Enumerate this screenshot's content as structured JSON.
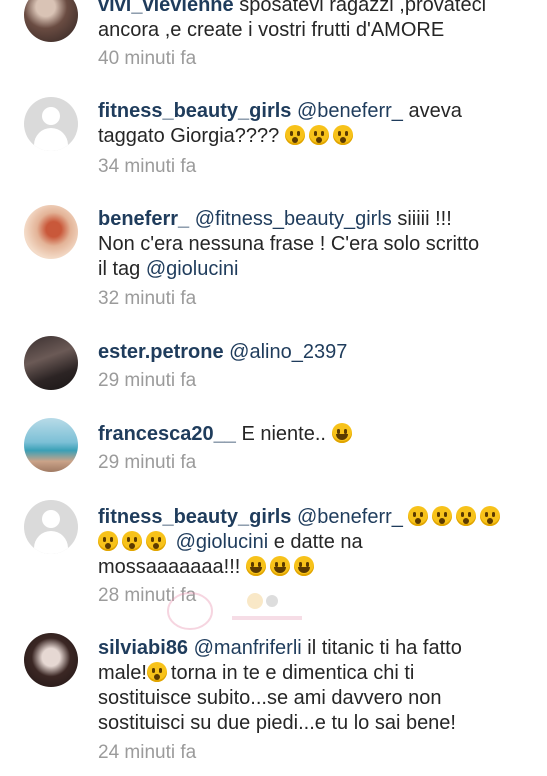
{
  "comments": [
    {
      "user": "vivi_vievienne",
      "parts": [
        "sposatevi ragazzi ,provateci",
        "ancora ,e create i vostri frutti d'AMORE"
      ],
      "time": "40 minuti fa"
    },
    {
      "user": "fitness_beauty_girls",
      "mention": "@beneferr_",
      "text_a": " aveva",
      "text_b": "taggato Giorgia????",
      "time": "34 minuti fa"
    },
    {
      "user": "beneferr_",
      "mention": "@fitness_beauty_girls",
      "text_a": " siiiii !!!",
      "text_b": "Non c'era nessuna frase ! C'era solo scritto",
      "text_c": "il tag ",
      "mention2": "@giolucini",
      "time": "32 minuti fa"
    },
    {
      "user": "ester.petrone",
      "mention": "@alino_2397",
      "time": "29 minuti fa"
    },
    {
      "user": "francesca20__",
      "text_a": " E niente..",
      "time": "29 minuti fa"
    },
    {
      "user": "fitness_beauty_girls",
      "mention": "@beneferr_",
      "mention2": "@giolucini",
      "text_c": " e datte na",
      "text_d": "mossaaaaaaa!!!",
      "time": "28 minuti fa"
    },
    {
      "user": "silviabi86",
      "mention": "@manfriferli",
      "text_a": " il titanic ti ha fatto",
      "text_b": "male!",
      "text_c": "torna in te e dimentica  chi ti",
      "text_d": "sostituisce subito...se ami davvero non",
      "text_e": "sostituisci su due piedi...e tu lo sai bene!",
      "time": "24 minuti fa"
    }
  ],
  "icons": {
    "emoji_scream": "face-screaming-emoji-icon",
    "emoji_laugh": "laughing-emoji-icon",
    "emoji_kiss": "kissing-emoji-icon"
  },
  "colors": {
    "username": "#1f3c5c",
    "text": "#262626",
    "timestamp": "#9b9b9b",
    "background": "#ffffff"
  }
}
